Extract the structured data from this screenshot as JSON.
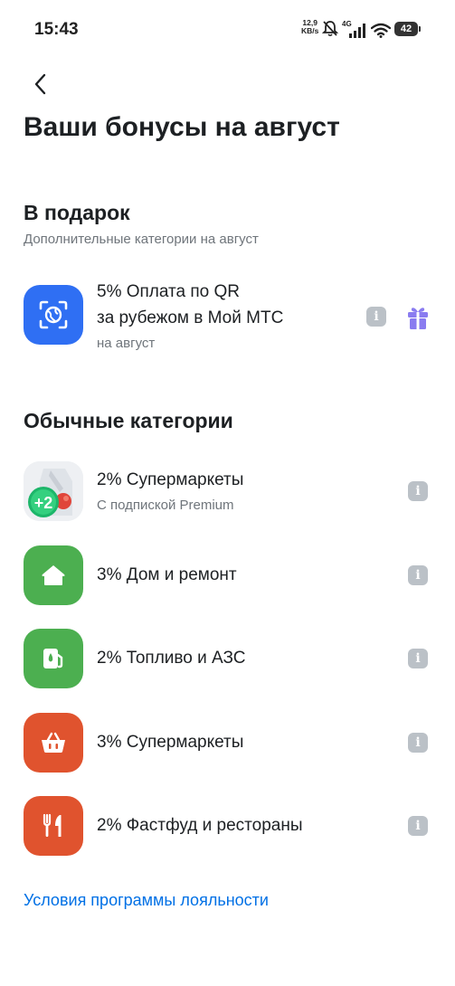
{
  "status_bar": {
    "time": "15:43",
    "speed_value": "12,9",
    "speed_unit": "KB/s",
    "network": "4G",
    "battery": "42"
  },
  "header": {
    "title": "Ваши бонусы на август"
  },
  "gift_section": {
    "title": "В подарок",
    "subtitle": "Дополнительные категории на август",
    "items": [
      {
        "title_line1": "5% Оплата по QR",
        "title_line2": "за рубежом в Мой МТС",
        "subtitle": "на август",
        "icon": "qr-scan-globe-icon",
        "color": "#2f6ff3"
      }
    ]
  },
  "regular_section": {
    "title": "Обычные категории",
    "items": [
      {
        "title": "2% Супермаркеты",
        "subtitle": "С подпиской Premium",
        "icon": "premium-plus2-icon",
        "badge": "+2"
      },
      {
        "title": "3% Дом и ремонт",
        "icon": "house-icon",
        "color": "#4caf50"
      },
      {
        "title": "2% Топливо и АЗС",
        "icon": "fuel-pump-icon",
        "color": "#4caf50"
      },
      {
        "title": "3% Супермаркеты",
        "icon": "basket-icon",
        "color": "#e0532e"
      },
      {
        "title": "2% Фастфуд и рестораны",
        "icon": "fork-knife-icon",
        "color": "#e0532e"
      }
    ]
  },
  "footer": {
    "link": "Условия программы лояльности"
  },
  "colors": {
    "accent_link": "#0070e5",
    "gift_icon": "#8a7cf0",
    "info_icon": "#bbc1c7"
  }
}
